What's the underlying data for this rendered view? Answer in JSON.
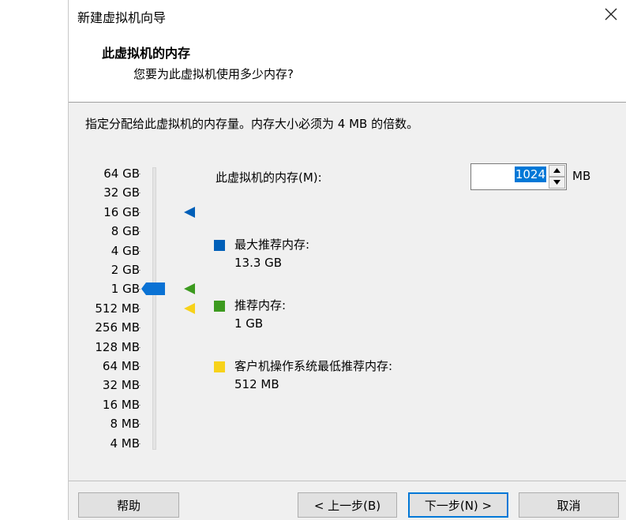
{
  "window": {
    "title": "新建虚拟机向导"
  },
  "header": {
    "title": "此虚拟机的内存",
    "subtitle": "您要为此虚拟机使用多少内存?"
  },
  "instruction": "指定分配给此虚拟机的内存量。内存大小必须为 4 MB 的倍数。",
  "scale": {
    "labels": [
      "64 GB",
      "32 GB",
      "16 GB",
      "8 GB",
      "4 GB",
      "2 GB",
      "1 GB",
      "512 MB",
      "256 MB",
      "128 MB",
      "64 MB",
      "32 MB",
      "16 MB",
      "8 MB",
      "4 MB"
    ],
    "selected": "1 GB"
  },
  "memory": {
    "label": "此虚拟机的内存(M):",
    "value": "1024",
    "unit": "MB"
  },
  "legend": [
    {
      "title": "最大推荐内存:",
      "value": "13.3 GB",
      "color": "#005fb8",
      "marker_at": "16 GB"
    },
    {
      "title": "推荐内存:",
      "value": "1 GB",
      "color": "#3c9a1f",
      "marker_at": "1 GB"
    },
    {
      "title": "客户机操作系统最低推荐内存:",
      "value": "512 MB",
      "color": "#f7d21a",
      "marker_at": "512 MB"
    }
  ],
  "colors": {
    "selection": "#0078d7",
    "slider_thumb": "#0a72d4"
  },
  "buttons": {
    "help": "帮助",
    "back": "< 上一步(B)",
    "next": "下一步(N) >",
    "cancel": "取消"
  }
}
